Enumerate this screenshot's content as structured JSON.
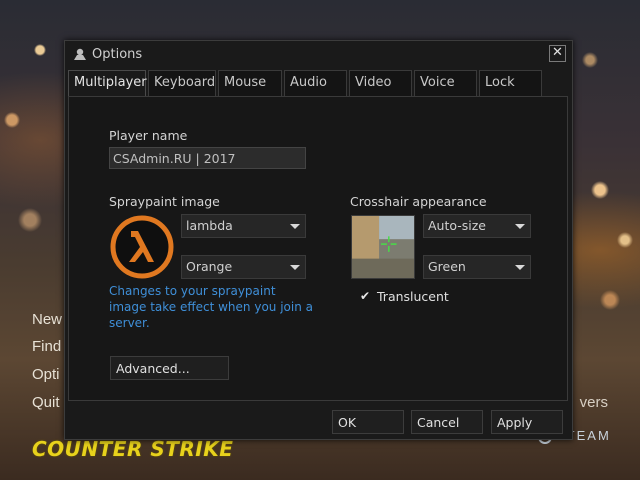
{
  "background_menu": {
    "items": [
      "New",
      "Find",
      "Opti",
      "Quit"
    ],
    "right_label": "vers"
  },
  "logo": {
    "text": "COUNTER STRIKE"
  },
  "steam": {
    "text": "STEAM"
  },
  "dialog": {
    "title": "Options",
    "close_glyph": "✕",
    "tabs": [
      "Multiplayer",
      "Keyboard",
      "Mouse",
      "Audio",
      "Video",
      "Voice",
      "Lock"
    ],
    "active_tab": "Multiplayer",
    "player_name": {
      "label": "Player name",
      "value": "CSAdmin.RU | 2017"
    },
    "spraypaint": {
      "label": "Spraypaint image",
      "image_select": "lambda",
      "color_select": "Orange",
      "hint": "Changes to your spraypaint image take effect when you join a server."
    },
    "crosshair": {
      "label": "Crosshair appearance",
      "size_select": "Auto-size",
      "color_select": "Green",
      "translucent_label": "Translucent",
      "translucent_checked": true,
      "check_glyph": "✔"
    },
    "advanced_button": "Advanced...",
    "footer": {
      "ok": "OK",
      "cancel": "Cancel",
      "apply": "Apply"
    }
  },
  "colors": {
    "hint_text": "#3f8fd8",
    "logo_yellow": "#e8d21c",
    "lambda_orange": "#e07820"
  }
}
